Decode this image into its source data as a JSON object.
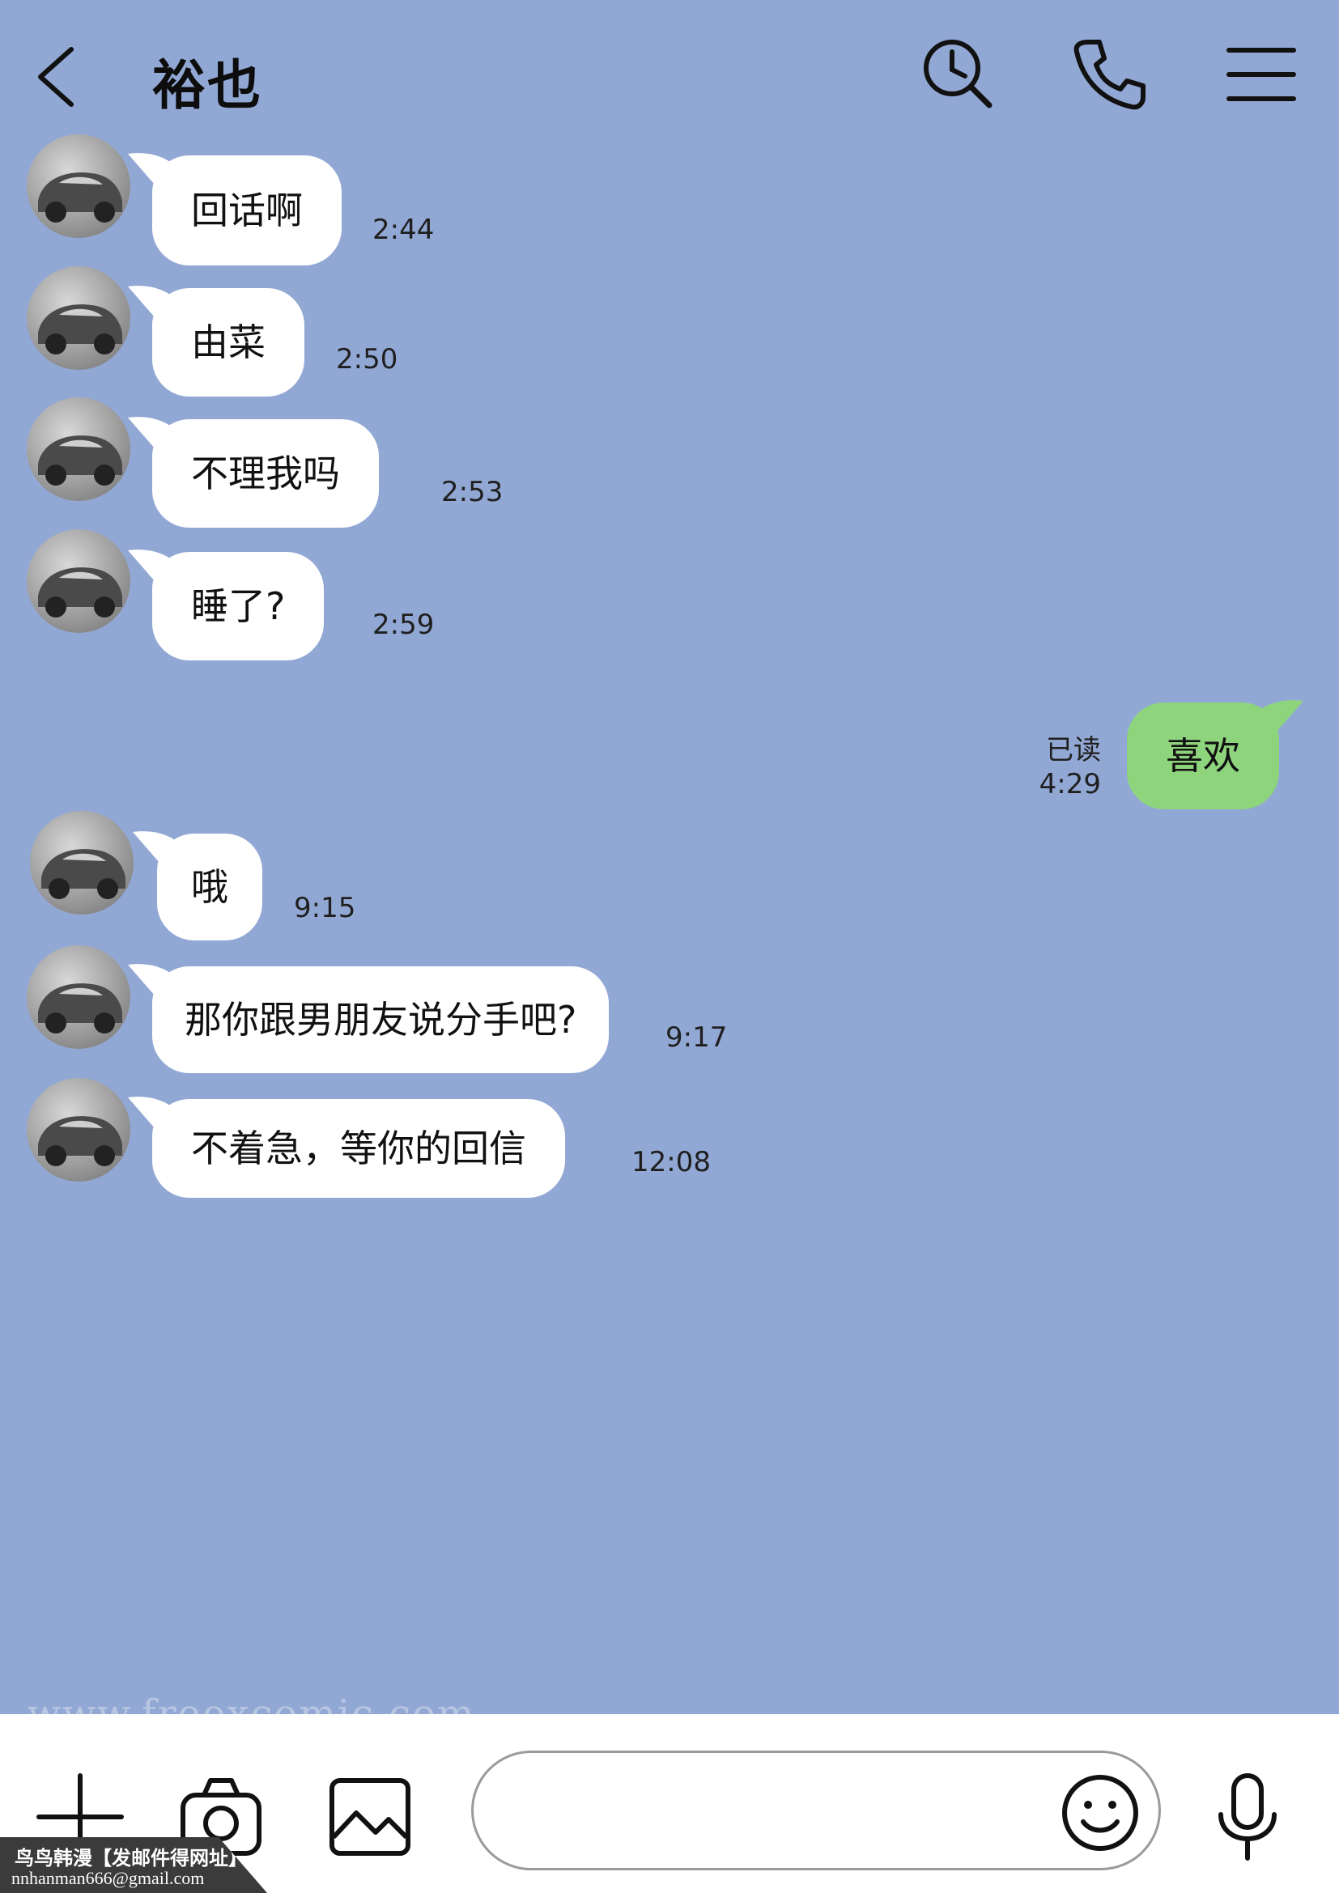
{
  "header": {
    "title": "裕也"
  },
  "messages": [
    {
      "text": "回话啊",
      "time": "2:44"
    },
    {
      "text": "由菜",
      "time": "2:50"
    },
    {
      "text": "不理我吗",
      "time": "2:53"
    },
    {
      "text": "睡了?",
      "time": "2:59"
    },
    {
      "text": "喜欢",
      "read": "已读",
      "time": "4:29"
    },
    {
      "text": "哦",
      "time": "9:15"
    },
    {
      "text": "那你跟男朋友说分手吧?",
      "time": "9:17"
    },
    {
      "text": "不着急，等你的回信",
      "time": "12:08"
    }
  ],
  "input": {
    "value": ""
  },
  "watermark": {
    "url": "www.freexcomic.com",
    "badge_title": "鸟鸟韩漫【发邮件得网址】",
    "badge_email": "nnhanman666@gmail.com"
  },
  "colors": {
    "background": "#92a8d4",
    "incoming_bubble": "#ffffff",
    "outgoing_bubble": "#8ed47d"
  },
  "icons": [
    "back-icon",
    "search-history-icon",
    "phone-icon",
    "menu-icon",
    "plus-icon",
    "camera-icon",
    "image-icon",
    "emoji-icon",
    "microphone-icon"
  ]
}
